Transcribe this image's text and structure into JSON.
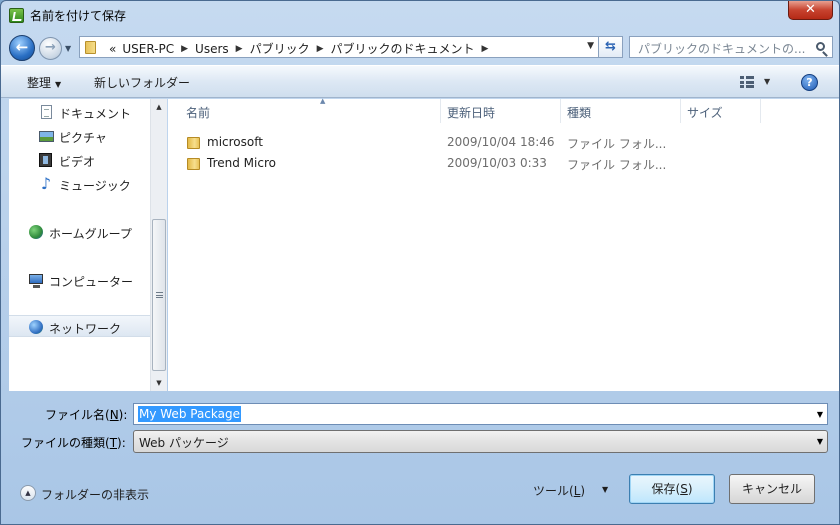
{
  "window": {
    "title": "名前を付けて保存",
    "close_label": "✕"
  },
  "address": {
    "overflow": "«",
    "crumbs": [
      "USER-PC",
      "Users",
      "パブリック",
      "パブリックのドキュメント"
    ],
    "search_placeholder": "パブリックのドキュメントの..."
  },
  "toolbar": {
    "organize_label": "整理",
    "new_folder_label": "新しいフォルダー",
    "help_label": "?"
  },
  "nav": {
    "items": [
      {
        "label": "ドキュメント",
        "icon": "document-icon"
      },
      {
        "label": "ピクチャ",
        "icon": "pictures-icon"
      },
      {
        "label": "ビデオ",
        "icon": "video-icon"
      },
      {
        "label": "ミュージック",
        "icon": "music-icon"
      },
      {
        "label": "ホームグループ",
        "icon": "homegroup-icon"
      },
      {
        "label": "コンピューター",
        "icon": "computer-icon"
      },
      {
        "label": "ネットワーク",
        "icon": "network-icon"
      }
    ]
  },
  "files": {
    "columns": [
      "名前",
      "更新日時",
      "種類",
      "サイズ"
    ],
    "rows": [
      {
        "name": "microsoft",
        "modified": "2009/10/04 18:46",
        "type": "ファイル フォル..."
      },
      {
        "name": "Trend Micro",
        "modified": "2009/10/03 0:33",
        "type": "ファイル フォル..."
      }
    ]
  },
  "form": {
    "filename_label_pre": "ファイル名(",
    "filename_label_key": "N",
    "filename_label_post": "):",
    "filename_value": "My Web Package",
    "filetype_label_pre": "ファイルの種類(",
    "filetype_label_key": "T",
    "filetype_label_post": "):",
    "filetype_value": "Web パッケージ"
  },
  "footer": {
    "hide_folders_label": "フォルダーの非表示",
    "tools_pre": "ツール(",
    "tools_key": "L",
    "tools_post": ")",
    "save_pre": "保存(",
    "save_key": "S",
    "save_post": ")",
    "cancel_label": "キャンセル"
  }
}
